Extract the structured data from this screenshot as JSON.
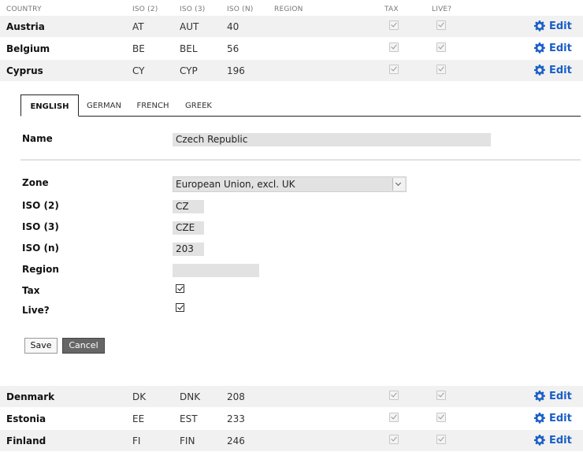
{
  "columns": {
    "country": "COUNTRY",
    "iso2": "ISO (2)",
    "iso3": "ISO (3)",
    "ison": "ISO (N)",
    "region": "REGION",
    "tax": "TAX",
    "live": "LIVE?"
  },
  "rows_top": [
    {
      "country": "Austria",
      "iso2": "AT",
      "iso3": "AUT",
      "ison": "40",
      "region": "",
      "tax": true,
      "live": true,
      "edit": "Edit"
    },
    {
      "country": "Belgium",
      "iso2": "BE",
      "iso3": "BEL",
      "ison": "56",
      "region": "",
      "tax": true,
      "live": true,
      "edit": "Edit"
    },
    {
      "country": "Cyprus",
      "iso2": "CY",
      "iso3": "CYP",
      "ison": "196",
      "region": "",
      "tax": true,
      "live": true,
      "edit": "Edit"
    }
  ],
  "editor": {
    "tabs": [
      "ENGLISH",
      "GERMAN",
      "FRENCH",
      "GREEK"
    ],
    "active_tab": "ENGLISH",
    "name_label": "Name",
    "name_value": "Czech Republic",
    "zone_label": "Zone",
    "zone_value": "European Union, excl. UK",
    "iso2_label": "ISO (2)",
    "iso2_value": "CZ",
    "iso3_label": "ISO (3)",
    "iso3_value": "CZE",
    "ison_label": "ISO (n)",
    "ison_value": "203",
    "region_label": "Region",
    "region_value": "",
    "tax_label": "Tax",
    "tax_checked": true,
    "live_label": "Live?",
    "live_checked": true,
    "save_label": "Save",
    "cancel_label": "Cancel"
  },
  "rows_bottom": [
    {
      "country": "Denmark",
      "iso2": "DK",
      "iso3": "DNK",
      "ison": "208",
      "region": "",
      "tax": true,
      "live": true,
      "edit": "Edit"
    },
    {
      "country": "Estonia",
      "iso2": "EE",
      "iso3": "EST",
      "ison": "233",
      "region": "",
      "tax": true,
      "live": true,
      "edit": "Edit"
    },
    {
      "country": "Finland",
      "iso2": "FI",
      "iso3": "FIN",
      "ison": "246",
      "region": "",
      "tax": true,
      "live": true,
      "edit": "Edit"
    }
  ],
  "icons": {
    "edit": "gear-icon",
    "tax": "checkmark-icon",
    "live": "checkmark-icon",
    "zone": "chevron-down-icon"
  },
  "colors": {
    "accent": "#1a5ec7",
    "row_alt": "#f1f1f1",
    "field_bg": "#e2e2e2",
    "cancel_bg": "#666666"
  }
}
